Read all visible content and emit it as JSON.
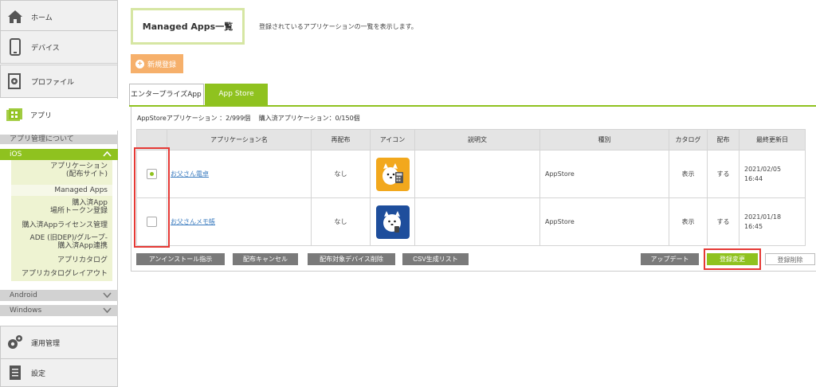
{
  "sidebar": {
    "home": "ホーム",
    "devices": "デバイス",
    "profiles": "プロファイル",
    "apps": "アプリ",
    "about_app_management": "アプリ管理について",
    "ios": {
      "label": "iOS",
      "items": [
        "アプリケーション\n(配布サイト)",
        "Managed Apps",
        "購入済App\n場所トークン登録",
        "購入済Appライセンス管理",
        "ADE (旧DEP)/グループ-\n購入済App連携",
        "アプリカタログ",
        "アプリカタログレイアウト"
      ],
      "selected_index": 1
    },
    "android": "Android",
    "windows": "Windows",
    "operations": "運用管理",
    "settings": "設定"
  },
  "page": {
    "title": "Managed Apps一覧",
    "description": "登録されているアプリケーションの一覧を表示します。",
    "new_button": "新規登録",
    "tabs": [
      "エンタープライズApp",
      "App Store"
    ],
    "active_tab": 1,
    "summary_apps": "AppStoreアプリケーション ：2/999個",
    "summary_purchased": "購入済アプリケーション：0/150個"
  },
  "table": {
    "headers": [
      "アプリケーション名",
      "再配布",
      "アイコン",
      "説明文",
      "種別",
      "カタログ",
      "配布",
      "最終更新日"
    ],
    "rows": [
      {
        "checked": true,
        "name": "お父さん電卓",
        "redistribute": "なし",
        "description": "",
        "type": "AppStore",
        "catalog": "表示",
        "distribute": "する",
        "updated": "2021/02/05\n16:44",
        "icon_bg": "#f2a81d"
      },
      {
        "checked": false,
        "name": "お父さんメモ帳",
        "redistribute": "なし",
        "description": "",
        "type": "AppStore",
        "catalog": "表示",
        "distribute": "する",
        "updated": "2021/01/18\n16:45",
        "icon_bg": "#1e4e9c"
      }
    ]
  },
  "actions": {
    "uninstall": "アンインストール指示",
    "cancel_distribution": "配布キャンセル",
    "remove_target_devices": "配布対象デバイス削除",
    "csv": "CSV生成リスト",
    "update": "アップデート",
    "register_change": "登録変更",
    "register_delete": "登録削除"
  },
  "colors": {
    "accent": "#8fc21f",
    "highlight": "#e53935",
    "new_button": "#f6b06b"
  }
}
